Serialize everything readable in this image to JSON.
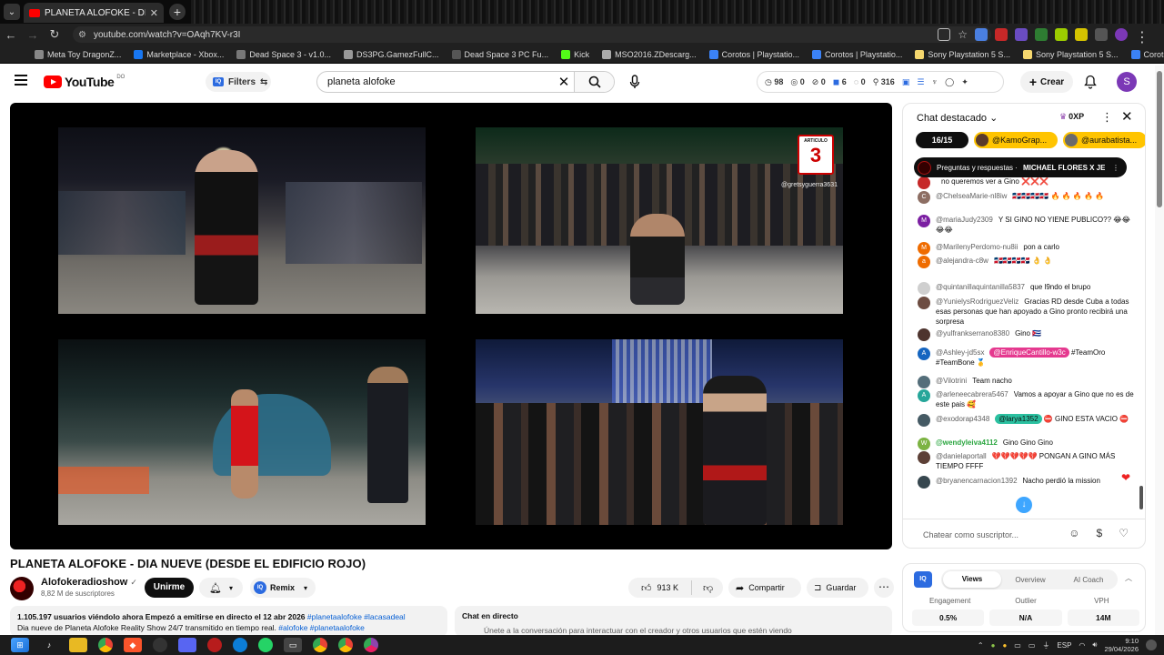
{
  "browser": {
    "tab_title": "PLANETA ALOFOKE - DIA N",
    "url": "youtube.com/watch?v=OAqh7KV-r3I",
    "bookmarks": [
      {
        "label": "Meta Toy DragonZ...",
        "color": "#888888"
      },
      {
        "label": "Marketplace - Xbox...",
        "color": "#1877f2"
      },
      {
        "label": "Dead Space 3 - v1.0...",
        "color": "#777777"
      },
      {
        "label": "DS3PG.GamezFullC...",
        "color": "#999999"
      },
      {
        "label": "Dead Space 3 PC Fu...",
        "color": "#555555"
      },
      {
        "label": "Kick",
        "color": "#53fc18"
      },
      {
        "label": "MSO2016.ZDescarg...",
        "color": "#aaaaaa"
      },
      {
        "label": "Corotos | Playstatio...",
        "color": "#3b82f6"
      },
      {
        "label": "Corotos | Playstatio...",
        "color": "#3b82f6"
      },
      {
        "label": "Sony Playstation 5 S...",
        "color": "#f5d76e"
      },
      {
        "label": "Sony Playstation 5 S...",
        "color": "#f5d76e"
      },
      {
        "label": "Corotos | Playstatio...",
        "color": "#3b82f6"
      }
    ]
  },
  "header": {
    "logo_text": "YouTube",
    "logo_country": "DO",
    "filters_label": "Filters",
    "search_value": "planeta alofoke",
    "stats": [
      "98",
      "0",
      "0",
      "6",
      "0",
      "316"
    ],
    "create_label": "Crear",
    "avatar_letter": "S"
  },
  "video": {
    "title": "PLANETA ALOFOKE - DIA NUEVE (DESDE EL EDIFICIO ROJO)",
    "watermark": "@gretsyguerra3631",
    "badge_text": "ARTICULO",
    "badge_number": "3",
    "channel_name": "Alofokeradioshow",
    "subscribers": "8,82 M de suscriptores",
    "join_label": "Unirme",
    "remix_label": "Remix",
    "likes": "913 K",
    "share_label": "Compartir",
    "save_label": "Guardar",
    "desc_line1": "1.105.197 usuarios viéndolo ahora  Empezó a emitirse en directo el 12 abr 2026",
    "desc_tags1": "#planetaalofoke #lacasadeal",
    "desc_line2": "Dia nueve de Planeta Alofoke Reality Show 24/7 transmitido en tiempo real.",
    "desc_tags2": "#alofoke #planetaalofoke",
    "live_chat_title": "Chat en directo",
    "live_chat_sub": "Únete a la conversación para interactuar con el creador y otros usuarios que estén viendo"
  },
  "chat": {
    "header": "Chat destacado",
    "xp": "0XP",
    "pin_count": "16/15",
    "pins": [
      "@KamoGrap...",
      "@aurabatista..."
    ],
    "qa_prefix": "Preguntas y respuestas ·",
    "qa_title": "MICHAEL FLORES X JE...",
    "messages": [
      {
        "av": "",
        "color": "#c62828",
        "author": "",
        "text": "no queremos ver a Gino ❌❌❌"
      },
      {
        "av": "C",
        "color": "#8d6e63",
        "author": "@ChelseaMarie-nl8iw",
        "text": "🇩🇴🇩🇴🇩🇴🇩🇴 🔥 🔥 🔥 🔥 🔥"
      },
      {
        "av": "M",
        "color": "#7b1fa2",
        "author": "@mariaJudy2309",
        "text": "Y SI GINO NO YIENE PUBLICO?? 😂😂😂😂"
      },
      {
        "av": "M",
        "color": "#ef6c00",
        "author": "@MarilenyPerdomo-nu8ii",
        "text": "pon a carlo"
      },
      {
        "av": "a",
        "color": "#ef6c00",
        "author": "@alejandra-c8w",
        "text": "🇩🇴🇩🇴🇩🇴🇩🇴 👌 👌"
      },
      {
        "av": "",
        "color": "#cfcfcf",
        "author": "@quintanillaquintanilla5837",
        "text": "que l9ndo el brupo"
      },
      {
        "av": "",
        "color": "#6d4c41",
        "author": "@YunielysRodriguezVeliz",
        "text": "Gracias RD desde Cuba a todas esas personas que han apoyado a Gino pronto recibirá una sorpresa"
      },
      {
        "av": "",
        "color": "#4e342e",
        "author": "@yulfrankserrano8380",
        "text": "Gino 🇨🇺"
      },
      {
        "av": "A",
        "color": "#1565c0",
        "author": "@Ashley-jd5sx",
        "mention": "@EnriqueCantillo-w3c",
        "text": "#TeamOro #TeamBone 🥇"
      },
      {
        "av": "",
        "color": "#546e7a",
        "author": "@Vilotrini",
        "text": "Team nacho"
      },
      {
        "av": "A",
        "color": "#26a69a",
        "author": "@arleneecabrera5467",
        "text": "Vamos a apoyar a Gino que no es de este pais 🥰"
      },
      {
        "av": "",
        "color": "#455a64",
        "author": "@exodorap4348",
        "mention": "@larya1352",
        "text": "⛔ GINO ESTA VACIO ⛔"
      },
      {
        "av": "W",
        "color": "#7cb342",
        "author": "@wendyleiva4112",
        "text": "Gino Gino Gino"
      },
      {
        "av": "",
        "color": "#5d4037",
        "author": "@danielaportall",
        "text": "💔💔💔💔💔 PONGAN A GINO MÁS TIEMPO FFFF"
      },
      {
        "av": "",
        "color": "#37474f",
        "author": "@bryanencarnacion1392",
        "text": "Nacho perdió la mission"
      }
    ],
    "input_placeholder": "Chatear como suscriptor..."
  },
  "analytics": {
    "logo": "IQ",
    "tabs": [
      "Views",
      "Overview",
      "AI Coach"
    ],
    "labels": [
      "Engagement",
      "Outlier",
      "VPH"
    ],
    "values": [
      "0.5%",
      "N/A",
      "14M"
    ]
  },
  "taskbar": {
    "lang": "ESP",
    "time": "9:10",
    "date": "29/04/2026"
  }
}
